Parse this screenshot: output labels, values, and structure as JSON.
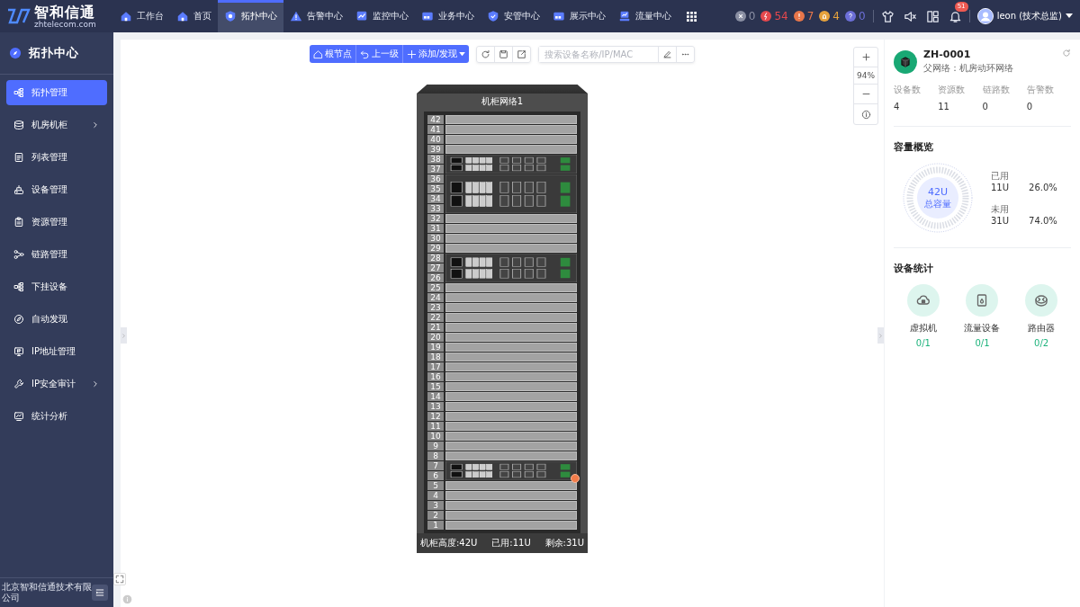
{
  "logo": {
    "name": "智和信通",
    "domain": "zhtelecom.com"
  },
  "nav_tabs": [
    {
      "label": "工作台",
      "selected": false
    },
    {
      "label": "首页",
      "selected": false
    },
    {
      "label": "拓扑中心",
      "selected": true
    },
    {
      "label": "告警中心",
      "selected": false
    },
    {
      "label": "监控中心",
      "selected": false
    },
    {
      "label": "业务中心",
      "selected": false
    },
    {
      "label": "安管中心",
      "selected": false
    },
    {
      "label": "展示中心",
      "selected": false
    },
    {
      "label": "流量中心",
      "selected": false
    }
  ],
  "alert_counts": [
    {
      "kind": "unknown",
      "count": "0",
      "color": "#8a8fa3"
    },
    {
      "kind": "critical",
      "count": "54",
      "color": "#e5484d"
    },
    {
      "kind": "major",
      "count": "7",
      "color": "#e8764a"
    },
    {
      "kind": "minor",
      "count": "4",
      "color": "#e6a23c"
    },
    {
      "kind": "info",
      "count": "0",
      "color": "#6c6fd8"
    }
  ],
  "notification_count": "51",
  "user": "leon (技术总监)",
  "sidebar": {
    "title": "拓扑中心",
    "items": [
      {
        "label": "拓扑管理",
        "selected": true,
        "expandable": false
      },
      {
        "label": "机房机柜",
        "selected": false,
        "expandable": true
      },
      {
        "label": "列表管理",
        "selected": false,
        "expandable": false
      },
      {
        "label": "设备管理",
        "selected": false,
        "expandable": false
      },
      {
        "label": "资源管理",
        "selected": false,
        "expandable": false
      },
      {
        "label": "链路管理",
        "selected": false,
        "expandable": false
      },
      {
        "label": "下挂设备",
        "selected": false,
        "expandable": false
      },
      {
        "label": "自动发现",
        "selected": false,
        "expandable": false
      },
      {
        "label": "IP地址管理",
        "selected": false,
        "expandable": false
      },
      {
        "label": "IP安全审计",
        "selected": false,
        "expandable": true
      },
      {
        "label": "统计分析",
        "selected": false,
        "expandable": false
      }
    ],
    "footer": "北京智和信通技术有限公司"
  },
  "toolbar": {
    "buttons": [
      "根节点",
      "上一级",
      "添加/发现"
    ],
    "search": {
      "placeholder": "搜索设备名称/IP/MAC"
    }
  },
  "zoom": "94%",
  "rack": {
    "title": "机柜网络1",
    "rows": [
      {
        "kind": "empty",
        "slots": [
          "42"
        ]
      },
      {
        "kind": "empty",
        "slots": [
          "41"
        ]
      },
      {
        "kind": "empty",
        "slots": [
          "40"
        ]
      },
      {
        "kind": "empty",
        "slots": [
          "39"
        ]
      },
      {
        "kind": "device",
        "slots": [
          "38",
          "37"
        ],
        "alarm": false
      },
      {
        "kind": "device",
        "slots": [
          "36",
          "35",
          "34",
          "33"
        ],
        "alarm": false
      },
      {
        "kind": "empty",
        "slots": [
          "32"
        ]
      },
      {
        "kind": "empty",
        "slots": [
          "31"
        ]
      },
      {
        "kind": "empty",
        "slots": [
          "30"
        ]
      },
      {
        "kind": "empty",
        "slots": [
          "29"
        ]
      },
      {
        "kind": "device",
        "slots": [
          "28",
          "27",
          "26"
        ],
        "alarm": false
      },
      {
        "kind": "empty",
        "slots": [
          "25"
        ]
      },
      {
        "kind": "empty",
        "slots": [
          "24"
        ]
      },
      {
        "kind": "empty",
        "slots": [
          "23"
        ]
      },
      {
        "kind": "empty",
        "slots": [
          "22"
        ]
      },
      {
        "kind": "empty",
        "slots": [
          "21"
        ]
      },
      {
        "kind": "empty",
        "slots": [
          "20"
        ]
      },
      {
        "kind": "empty",
        "slots": [
          "19"
        ]
      },
      {
        "kind": "empty",
        "slots": [
          "18"
        ]
      },
      {
        "kind": "empty",
        "slots": [
          "17"
        ]
      },
      {
        "kind": "empty",
        "slots": [
          "16"
        ]
      },
      {
        "kind": "empty",
        "slots": [
          "15"
        ]
      },
      {
        "kind": "empty",
        "slots": [
          "14"
        ]
      },
      {
        "kind": "empty",
        "slots": [
          "13"
        ]
      },
      {
        "kind": "empty",
        "slots": [
          "12"
        ]
      },
      {
        "kind": "empty",
        "slots": [
          "11"
        ]
      },
      {
        "kind": "empty",
        "slots": [
          "10"
        ]
      },
      {
        "kind": "empty",
        "slots": [
          "9"
        ]
      },
      {
        "kind": "empty",
        "slots": [
          "8"
        ]
      },
      {
        "kind": "device",
        "slots": [
          "7",
          "6"
        ],
        "alarm": true
      },
      {
        "kind": "empty",
        "slots": [
          "5"
        ]
      },
      {
        "kind": "empty",
        "slots": [
          "4"
        ]
      },
      {
        "kind": "empty",
        "slots": [
          "3"
        ]
      },
      {
        "kind": "empty",
        "slots": [
          "2"
        ]
      },
      {
        "kind": "empty",
        "slots": [
          "1"
        ]
      }
    ],
    "footer": [
      "机柜高度:42U",
      "已用:11U",
      "剩余:31U"
    ]
  },
  "details": {
    "name": "ZH-0001",
    "parent": "父网络：机房动环网络",
    "stats": [
      {
        "label": "设备数",
        "value": "4"
      },
      {
        "label": "资源数",
        "value": "11"
      },
      {
        "label": "链路数",
        "value": "0"
      },
      {
        "label": "告警数",
        "value": "0"
      }
    ],
    "capacity": {
      "title": "容量概览",
      "total": "42U",
      "total_label": "总容量",
      "items": [
        {
          "label": "已用",
          "value": "11U",
          "percent": "26.0%"
        },
        {
          "label": "未用",
          "value": "31U",
          "percent": "74.0%"
        }
      ]
    },
    "device_stats": {
      "title": "设备统计",
      "items": [
        {
          "label": "虚拟机",
          "value": "0/1"
        },
        {
          "label": "流量设备",
          "value": "0/1"
        },
        {
          "label": "路由器",
          "value": "0/2"
        }
      ]
    }
  }
}
